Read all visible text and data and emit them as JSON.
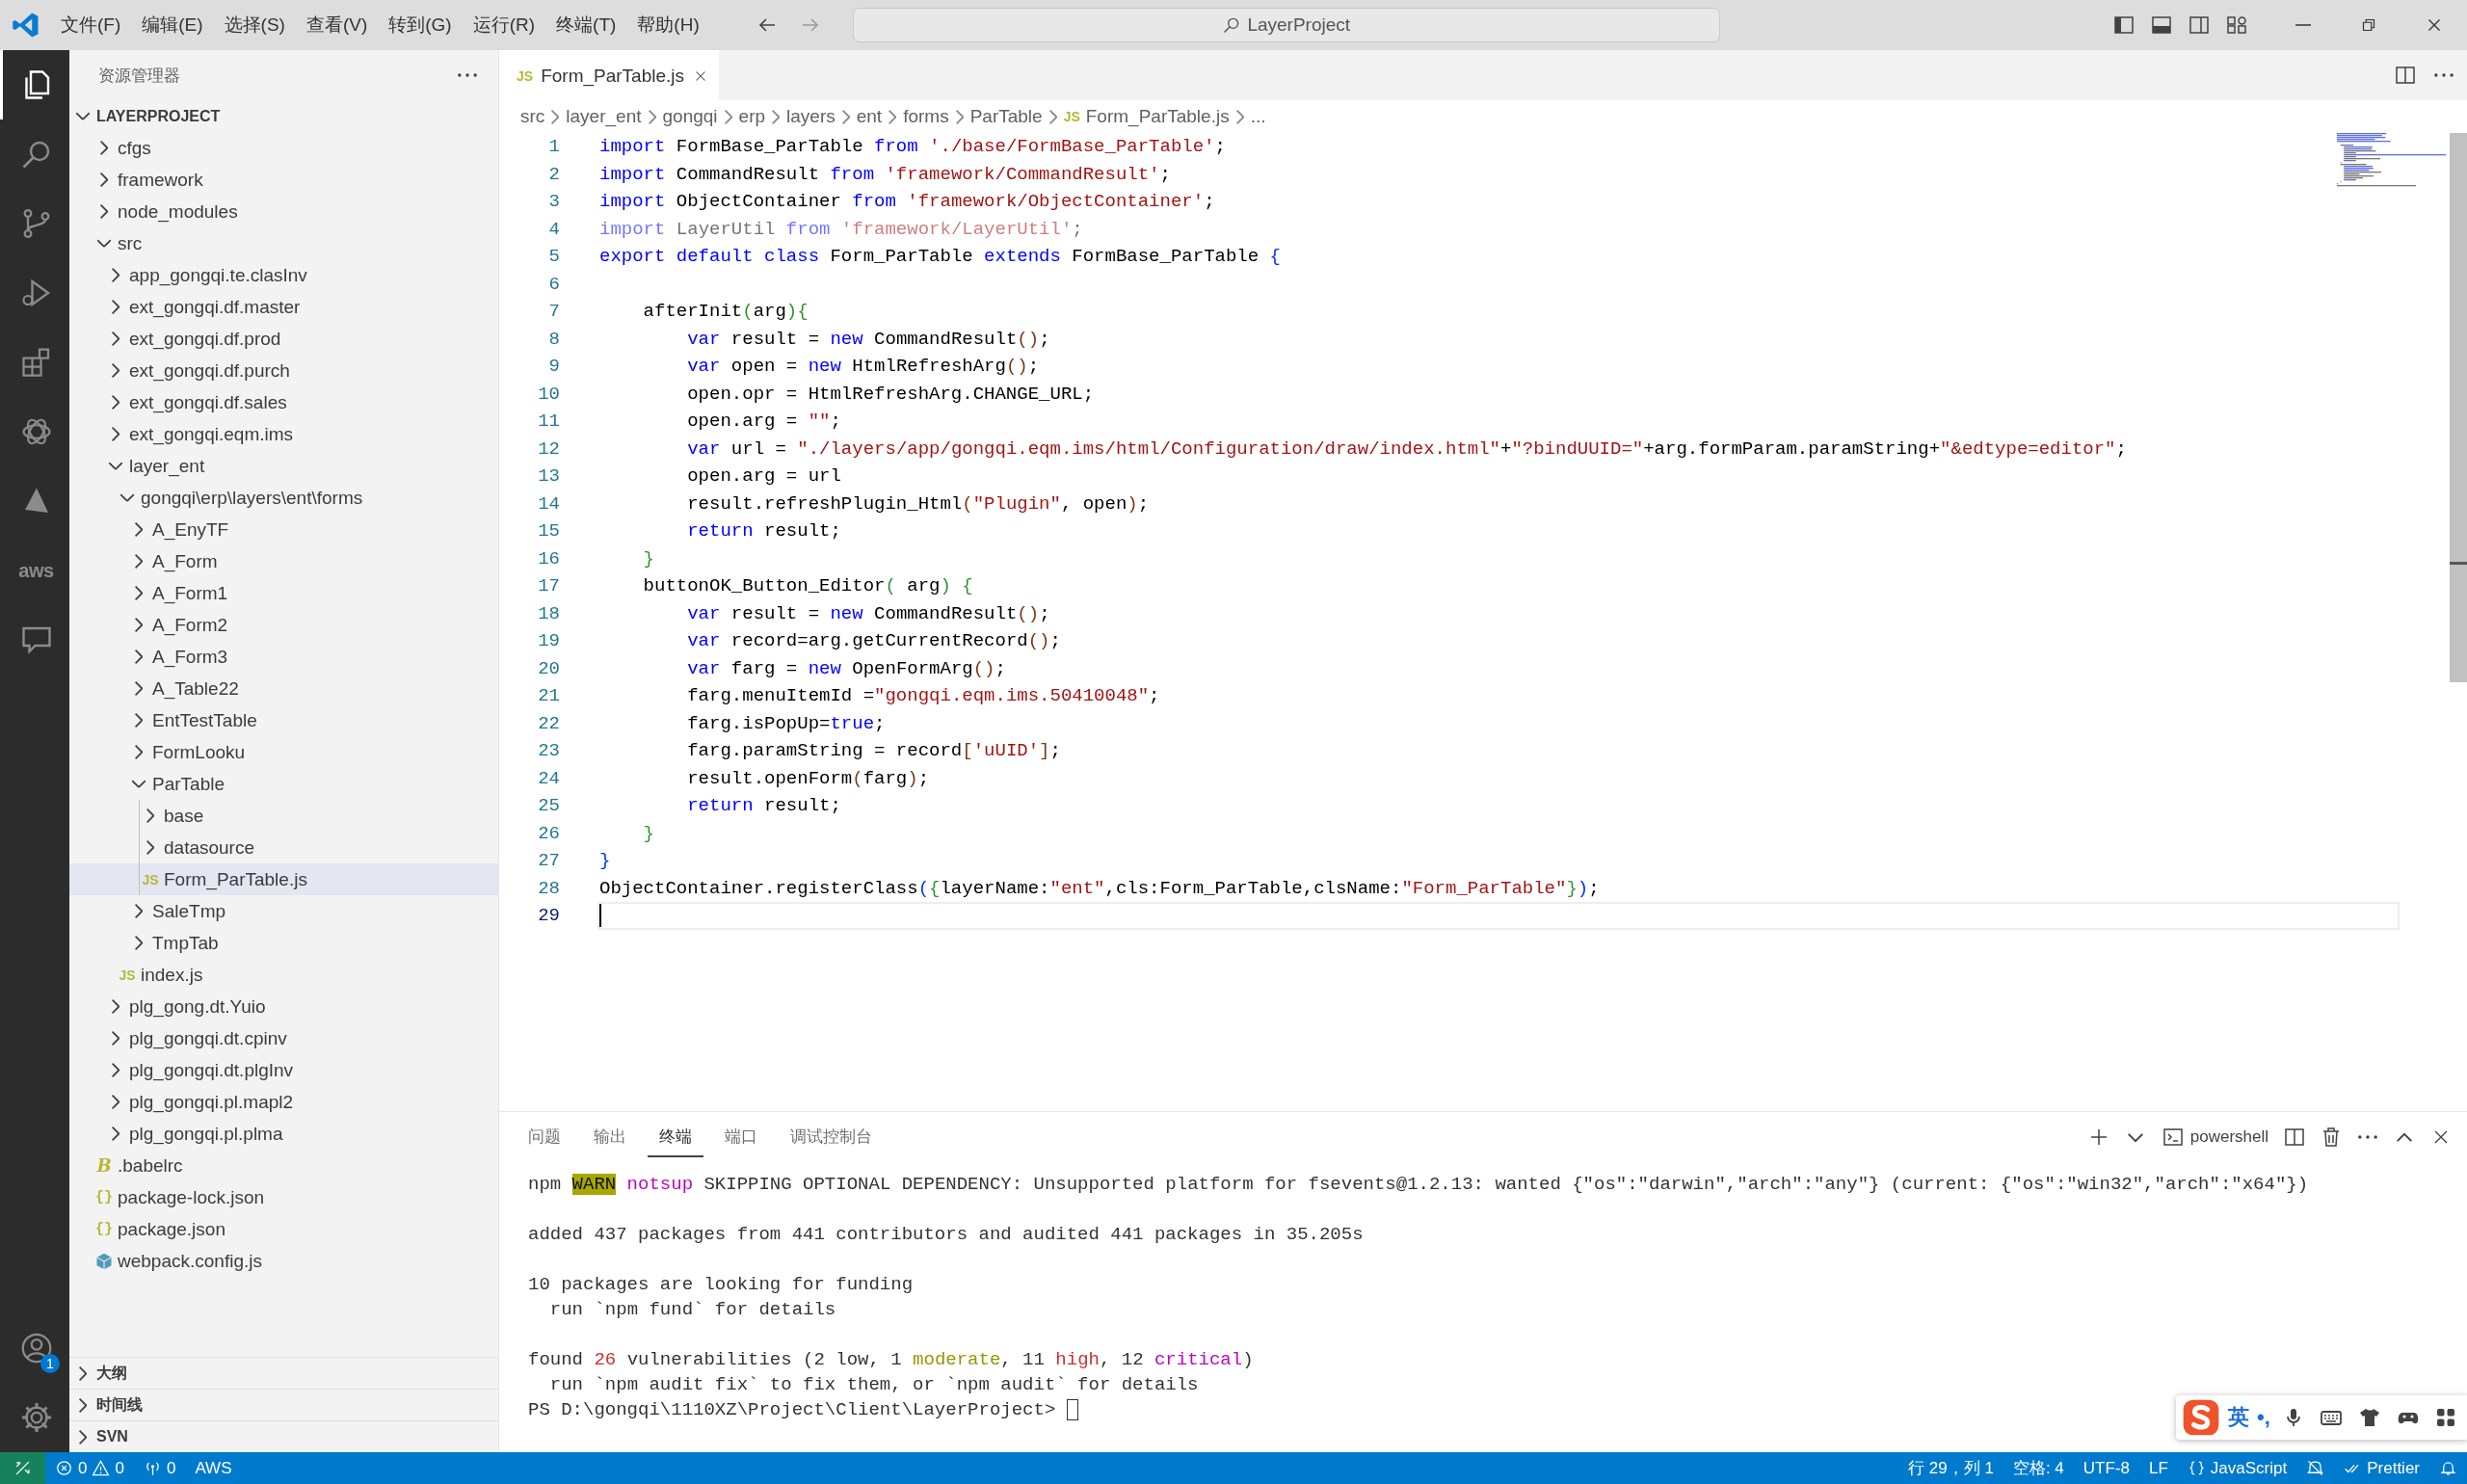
{
  "title_bar": {
    "menus": [
      "文件(F)",
      "编辑(E)",
      "选择(S)",
      "查看(V)",
      "转到(G)",
      "运行(R)",
      "终端(T)",
      "帮助(H)"
    ],
    "search": "LayerProject"
  },
  "activity_bar": {
    "items": [
      {
        "kind": "files",
        "selected": true
      },
      {
        "kind": "search",
        "selected": false
      },
      {
        "kind": "source-control",
        "selected": false
      },
      {
        "kind": "run",
        "selected": false
      },
      {
        "kind": "extensions",
        "selected": false
      },
      {
        "kind": "flower",
        "selected": false
      },
      {
        "kind": "triangle",
        "selected": false
      },
      {
        "kind": "aws",
        "text": "aws",
        "selected": false
      },
      {
        "kind": "chat",
        "selected": false
      }
    ],
    "account_badge": "1"
  },
  "sidebar": {
    "title": "资源管理器",
    "project": {
      "label": "LAYERPROJECT",
      "expanded": true,
      "children": [
        {
          "label": "cfgs",
          "kind": "folder",
          "expanded": false,
          "selected": false
        },
        {
          "label": "framework",
          "kind": "folder",
          "expanded": false,
          "selected": false
        },
        {
          "label": "node_modules",
          "kind": "folder",
          "expanded": false,
          "selected": false
        },
        {
          "label": "src",
          "kind": "folder",
          "expanded": true,
          "selected": false,
          "children": [
            {
              "label": "app_gongqi.te.clasInv",
              "kind": "folder",
              "expanded": false,
              "selected": false
            },
            {
              "label": "ext_gongqi.df.master",
              "kind": "folder",
              "expanded": false,
              "selected": false
            },
            {
              "label": "ext_gongqi.df.prod",
              "kind": "folder",
              "expanded": false,
              "selected": false
            },
            {
              "label": "ext_gongqi.df.purch",
              "kind": "folder",
              "expanded": false,
              "selected": false
            },
            {
              "label": "ext_gongqi.df.sales",
              "kind": "folder",
              "expanded": false,
              "selected": false
            },
            {
              "label": "ext_gongqi.eqm.ims",
              "kind": "folder",
              "expanded": false,
              "selected": false
            },
            {
              "label": "layer_ent",
              "kind": "folder",
              "expanded": true,
              "selected": false,
              "children": [
                {
                  "label": "gongqi\\erp\\layers\\ent\\forms",
                  "kind": "folder",
                  "expanded": true,
                  "selected": false,
                  "children": [
                    {
                      "label": "A_EnyTF",
                      "kind": "folder",
                      "expanded": false,
                      "selected": false
                    },
                    {
                      "label": "A_Form",
                      "kind": "folder",
                      "expanded": false,
                      "selected": false
                    },
                    {
                      "label": "A_Form1",
                      "kind": "folder",
                      "expanded": false,
                      "selected": false
                    },
                    {
                      "label": "A_Form2",
                      "kind": "folder",
                      "expanded": false,
                      "selected": false
                    },
                    {
                      "label": "A_Form3",
                      "kind": "folder",
                      "expanded": false,
                      "selected": false
                    },
                    {
                      "label": "A_Table22",
                      "kind": "folder",
                      "expanded": false,
                      "selected": false
                    },
                    {
                      "label": "EntTestTable",
                      "kind": "folder",
                      "expanded": false,
                      "selected": false
                    },
                    {
                      "label": "FormLooku",
                      "kind": "folder",
                      "expanded": false,
                      "selected": false
                    },
                    {
                      "label": "ParTable",
                      "kind": "folder",
                      "expanded": true,
                      "selected": false,
                      "children": [
                        {
                          "label": "base",
                          "kind": "folder",
                          "expanded": false,
                          "selected": false
                        },
                        {
                          "label": "datasource",
                          "kind": "folder",
                          "expanded": false,
                          "selected": false
                        },
                        {
                          "label": "Form_ParTable.js",
                          "kind": "js",
                          "icon": "JS",
                          "selected": true
                        }
                      ]
                    },
                    {
                      "label": "SaleTmp",
                      "kind": "folder",
                      "expanded": false,
                      "selected": false
                    },
                    {
                      "label": "TmpTab",
                      "kind": "folder",
                      "expanded": false,
                      "selected": false
                    }
                  ]
                },
                {
                  "label": "index.js",
                  "kind": "js",
                  "icon": "JS",
                  "selected": false
                }
              ]
            },
            {
              "label": "plg_gong.dt.Yuio",
              "kind": "folder",
              "expanded": false,
              "selected": false
            },
            {
              "label": "plg_gongqi.dt.cpinv",
              "kind": "folder",
              "expanded": false,
              "selected": false
            },
            {
              "label": "plg_gongqi.dt.plgInv",
              "kind": "folder",
              "expanded": false,
              "selected": false
            },
            {
              "label": "plg_gongqi.pl.mapl2",
              "kind": "folder",
              "expanded": false,
              "selected": false
            },
            {
              "label": "plg_gongqi.pl.plma",
              "kind": "folder",
              "expanded": false,
              "selected": false
            }
          ]
        },
        {
          "label": ".babelrc",
          "kind": "babel",
          "icon": "B",
          "selected": false
        },
        {
          "label": "package-lock.json",
          "kind": "json",
          "icon": "{}",
          "selected": false
        },
        {
          "label": "package.json",
          "kind": "json",
          "icon": "{}",
          "selected": false
        },
        {
          "label": "webpack.config.js",
          "kind": "webpack",
          "selected": false
        }
      ]
    },
    "sections": [
      {
        "label": "大纲",
        "expanded": false
      },
      {
        "label": "时间线",
        "expanded": false
      },
      {
        "label": "SVN",
        "expanded": false
      }
    ]
  },
  "editor": {
    "tabs": [
      {
        "label": "Form_ParTable.js",
        "icon": "JS",
        "selected": true
      }
    ],
    "breadcrumb": [
      {
        "text": "src"
      },
      {
        "text": "layer_ent"
      },
      {
        "text": "gongqi"
      },
      {
        "text": "erp"
      },
      {
        "text": "layers"
      },
      {
        "text": "ent"
      },
      {
        "text": "forms"
      },
      {
        "text": "ParTable"
      },
      {
        "text": "Form_ParTable.js",
        "icon": "JS"
      },
      {
        "text": "..."
      }
    ],
    "lines": [
      {
        "n": "1",
        "tokens": [
          {
            "kind": "keyword",
            "text": "import"
          },
          {
            "kind": "plain",
            "text": " FormBase_ParTable "
          },
          {
            "kind": "keyword",
            "text": "from "
          },
          {
            "kind": "string",
            "text": "'./base/FormBase_ParTable'"
          },
          {
            "kind": "plain",
            "text": ";"
          }
        ]
      },
      {
        "n": "2",
        "tokens": [
          {
            "kind": "keyword",
            "text": "import"
          },
          {
            "kind": "plain",
            "text": " CommandResult "
          },
          {
            "kind": "keyword",
            "text": "from "
          },
          {
            "kind": "string",
            "text": "'framework/CommandResult'"
          },
          {
            "kind": "plain",
            "text": ";"
          }
        ]
      },
      {
        "n": "3",
        "tokens": [
          {
            "kind": "keyword",
            "text": "import"
          },
          {
            "kind": "plain",
            "text": " ObjectContainer "
          },
          {
            "kind": "keyword",
            "text": "from "
          },
          {
            "kind": "string",
            "text": "'framework/ObjectContainer'"
          },
          {
            "kind": "plain",
            "text": ";"
          }
        ]
      },
      {
        "n": "4",
        "faded": true,
        "tokens": [
          {
            "kind": "keyword",
            "text": "import"
          },
          {
            "kind": "plain",
            "text": " LayerUtil "
          },
          {
            "kind": "keyword",
            "text": "from "
          },
          {
            "kind": "string",
            "text": "'framework/LayerUtil'"
          },
          {
            "kind": "plain",
            "text": ";"
          }
        ]
      },
      {
        "n": "5",
        "tokens": [
          {
            "kind": "keyword",
            "text": "export default class"
          },
          {
            "kind": "plain",
            "text": " Form_ParTable "
          },
          {
            "kind": "keyword",
            "text": "extends"
          },
          {
            "kind": "plain",
            "text": " FormBase_ParTable "
          },
          {
            "kind": "bracket1",
            "text": "{"
          }
        ]
      },
      {
        "n": "6"
      },
      {
        "n": "7",
        "tokens": [
          {
            "kind": "plain",
            "text": "    afterInit"
          },
          {
            "kind": "bracket2",
            "text": "("
          },
          {
            "kind": "plain",
            "text": "arg"
          },
          {
            "kind": "bracket2",
            "text": "){"
          }
        ]
      },
      {
        "n": "8",
        "tokens": [
          {
            "kind": "keyword",
            "text": "        var"
          },
          {
            "kind": "plain",
            "text": " result = "
          },
          {
            "kind": "keyword",
            "text": "new"
          },
          {
            "kind": "plain",
            "text": " CommandResult"
          },
          {
            "kind": "bracket3",
            "text": "()"
          },
          {
            "kind": "plain",
            "text": ";"
          }
        ]
      },
      {
        "n": "9",
        "tokens": [
          {
            "kind": "keyword",
            "text": "        var"
          },
          {
            "kind": "plain",
            "text": " open = "
          },
          {
            "kind": "keyword",
            "text": "new"
          },
          {
            "kind": "plain",
            "text": " HtmlRefreshArg"
          },
          {
            "kind": "bracket3",
            "text": "()"
          },
          {
            "kind": "plain",
            "text": ";"
          }
        ]
      },
      {
        "n": "10",
        "tokens": [
          {
            "kind": "plain",
            "text": "        open.opr = HtmlRefreshArg.CHANGE_URL;"
          }
        ]
      },
      {
        "n": "11",
        "tokens": [
          {
            "kind": "plain",
            "text": "        open.arg = "
          },
          {
            "kind": "string",
            "text": "\"\""
          },
          {
            "kind": "plain",
            "text": ";"
          }
        ]
      },
      {
        "n": "12",
        "tokens": [
          {
            "kind": "keyword",
            "text": "        var"
          },
          {
            "kind": "plain",
            "text": " url = "
          },
          {
            "kind": "string",
            "text": "\"./layers/app/gongqi.eqm.ims/html/Configuration/draw/index.html\""
          },
          {
            "kind": "plain",
            "text": "+"
          },
          {
            "kind": "string",
            "text": "\"?bindUUID=\""
          },
          {
            "kind": "plain",
            "text": "+arg.formParam.paramString+"
          },
          {
            "kind": "string",
            "text": "\"&edtype=editor\""
          },
          {
            "kind": "plain",
            "text": ";"
          }
        ]
      },
      {
        "n": "13",
        "tokens": [
          {
            "kind": "plain",
            "text": "        open.arg = url"
          }
        ]
      },
      {
        "n": "14",
        "tokens": [
          {
            "kind": "plain",
            "text": "        result.refreshPlugin_Html"
          },
          {
            "kind": "bracket3",
            "text": "("
          },
          {
            "kind": "string",
            "text": "\"Plugin\""
          },
          {
            "kind": "plain",
            "text": ", open"
          },
          {
            "kind": "bracket3",
            "text": ")"
          },
          {
            "kind": "plain",
            "text": ";"
          }
        ]
      },
      {
        "n": "15",
        "tokens": [
          {
            "kind": "keyword",
            "text": "        return"
          },
          {
            "kind": "plain",
            "text": " result;"
          }
        ]
      },
      {
        "n": "16",
        "tokens": [
          {
            "kind": "bracket2",
            "text": "    }"
          }
        ]
      },
      {
        "n": "17",
        "tokens": [
          {
            "kind": "plain",
            "text": "    buttonOK_Button_Editor"
          },
          {
            "kind": "bracket2",
            "text": "("
          },
          {
            "kind": "plain",
            "text": " arg"
          },
          {
            "kind": "bracket2",
            "text": ") {"
          }
        ]
      },
      {
        "n": "18",
        "tokens": [
          {
            "kind": "keyword",
            "text": "        var"
          },
          {
            "kind": "plain",
            "text": " result = "
          },
          {
            "kind": "keyword",
            "text": "new"
          },
          {
            "kind": "plain",
            "text": " CommandResult"
          },
          {
            "kind": "bracket3",
            "text": "()"
          },
          {
            "kind": "plain",
            "text": ";"
          }
        ]
      },
      {
        "n": "19",
        "tokens": [
          {
            "kind": "keyword",
            "text": "        var"
          },
          {
            "kind": "plain",
            "text": " record=arg.getCurrentRecord"
          },
          {
            "kind": "bracket3",
            "text": "()"
          },
          {
            "kind": "plain",
            "text": ";"
          }
        ]
      },
      {
        "n": "20",
        "tokens": [
          {
            "kind": "keyword",
            "text": "        var"
          },
          {
            "kind": "plain",
            "text": " farg = "
          },
          {
            "kind": "keyword",
            "text": "new"
          },
          {
            "kind": "plain",
            "text": " OpenFormArg"
          },
          {
            "kind": "bracket3",
            "text": "()"
          },
          {
            "kind": "plain",
            "text": ";"
          }
        ]
      },
      {
        "n": "21",
        "tokens": [
          {
            "kind": "plain",
            "text": "        farg.menuItemId ="
          },
          {
            "kind": "string",
            "text": "\"gongqi.eqm.ims.50410048\""
          },
          {
            "kind": "plain",
            "text": ";"
          }
        ]
      },
      {
        "n": "22",
        "tokens": [
          {
            "kind": "plain",
            "text": "        farg.isPopUp="
          },
          {
            "kind": "keyword",
            "text": "true"
          },
          {
            "kind": "plain",
            "text": ";"
          }
        ]
      },
      {
        "n": "23",
        "tokens": [
          {
            "kind": "plain",
            "text": "        farg.paramString = record"
          },
          {
            "kind": "bracket3",
            "text": "["
          },
          {
            "kind": "string",
            "text": "'uUID'"
          },
          {
            "kind": "bracket3",
            "text": "]"
          },
          {
            "kind": "plain",
            "text": ";"
          }
        ]
      },
      {
        "n": "24",
        "tokens": [
          {
            "kind": "plain",
            "text": "        result.openForm"
          },
          {
            "kind": "bracket3",
            "text": "("
          },
          {
            "kind": "plain",
            "text": "farg"
          },
          {
            "kind": "bracket3",
            "text": ")"
          },
          {
            "kind": "plain",
            "text": ";"
          }
        ]
      },
      {
        "n": "25",
        "tokens": [
          {
            "kind": "keyword",
            "text": "        return"
          },
          {
            "kind": "plain",
            "text": " result;"
          }
        ]
      },
      {
        "n": "26",
        "tokens": [
          {
            "kind": "bracket2",
            "text": "    }"
          }
        ]
      },
      {
        "n": "27",
        "tokens": [
          {
            "kind": "bracket1",
            "text": "}"
          }
        ]
      },
      {
        "n": "28",
        "tokens": [
          {
            "kind": "plain",
            "text": "ObjectContainer.registerClass"
          },
          {
            "kind": "bracket1",
            "text": "("
          },
          {
            "kind": "bracket2",
            "text": "{"
          },
          {
            "kind": "plain",
            "text": "layerName:"
          },
          {
            "kind": "string",
            "text": "\"ent\""
          },
          {
            "kind": "plain",
            "text": ",cls:Form_ParTable,clsName:"
          },
          {
            "kind": "string",
            "text": "\"Form_ParTable\""
          },
          {
            "kind": "bracket2",
            "text": "}"
          },
          {
            "kind": "bracket1",
            "text": ")"
          },
          {
            "kind": "plain",
            "text": ";"
          }
        ]
      },
      {
        "n": "29",
        "current": true
      }
    ]
  },
  "panel": {
    "tabs": [
      {
        "label": "问题",
        "selected": false
      },
      {
        "label": "输出",
        "selected": false
      },
      {
        "label": "终端",
        "selected": true
      },
      {
        "label": "端口",
        "selected": false
      },
      {
        "label": "调试控制台",
        "selected": false
      }
    ],
    "shell": "powershell",
    "terminal": {
      "blocks": [
        [
          {
            "segments": [
              {
                "kind": "plain",
                "text": "npm "
              },
              {
                "kind": "warn",
                "text": "WARN"
              },
              {
                "kind": "magenta",
                "text": " notsup"
              },
              {
                "kind": "plain",
                "text": " SKIPPING OPTIONAL DEPENDENCY: Unsupported platform for fsevents@1.2.13: wanted {\"os\":\"darwin\",\"arch\":\"any\"} (current: {\"os\":\"win32\",\"arch\":\"x64\"})"
              }
            ]
          }
        ],
        [
          {
            "segments": [
              {
                "kind": "plain",
                "text": "added 437 packages from 441 contributors and audited 441 packages in 35.205s"
              }
            ]
          }
        ],
        [
          {
            "segments": [
              {
                "kind": "plain",
                "text": "10 packages are looking for funding"
              }
            ]
          },
          {
            "segments": [
              {
                "kind": "plain",
                "text": "  run `npm fund` for details"
              }
            ]
          }
        ],
        [
          {
            "segments": [
              {
                "kind": "plain",
                "text": "found "
              },
              {
                "kind": "red",
                "text": "26"
              },
              {
                "kind": "plain",
                "text": " vulnerabilities (2 low, 1 "
              },
              {
                "kind": "yellow",
                "text": "moderate"
              },
              {
                "kind": "plain",
                "text": ", 11 "
              },
              {
                "kind": "red",
                "text": "high"
              },
              {
                "kind": "plain",
                "text": ", 12 "
              },
              {
                "kind": "magenta",
                "text": "critical"
              },
              {
                "kind": "plain",
                "text": ")"
              }
            ]
          },
          {
            "segments": [
              {
                "kind": "plain",
                "text": "  run `npm audit fix` to fix them, or `npm audit` for details"
              }
            ]
          },
          {
            "segments": [
              {
                "kind": "plain",
                "text": "PS D:\\gongqi\\1110XZ\\Project\\Client\\LayerProject> "
              }
            ],
            "cursor": true
          }
        ]
      ]
    }
  },
  "status_bar": {
    "left": [
      {
        "kind": "remote"
      },
      {
        "kind": "problems",
        "errors": "0",
        "warnings": "0"
      },
      {
        "kind": "ports",
        "text": "0"
      },
      {
        "kind": "plain",
        "text": "AWS"
      }
    ],
    "right": [
      {
        "kind": "plain",
        "text": "行 29，列 1"
      },
      {
        "kind": "plain",
        "text": "空格: 4"
      },
      {
        "kind": "plain",
        "text": "UTF-8"
      },
      {
        "kind": "plain",
        "text": "LF"
      },
      {
        "kind": "language",
        "text": "JavaScript"
      },
      {
        "kind": "muted"
      },
      {
        "kind": "prettier",
        "text": "Prettier"
      },
      {
        "kind": "bell"
      }
    ]
  },
  "ime_bar": {
    "mode": "英",
    "punctuation": "•,"
  }
}
